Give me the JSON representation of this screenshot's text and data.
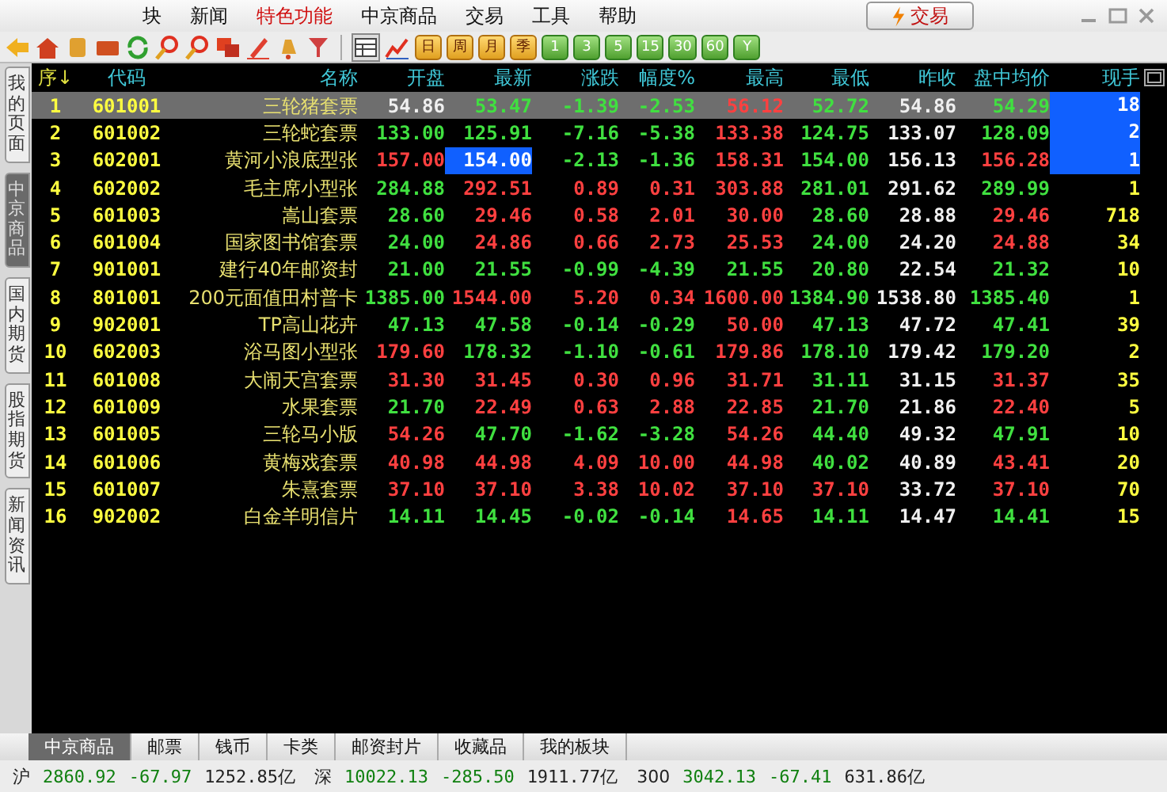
{
  "menu": [
    {
      "label": "块",
      "highlight": false
    },
    {
      "label": "新闻",
      "highlight": false
    },
    {
      "label": "特色功能",
      "highlight": true
    },
    {
      "label": "中京商品",
      "highlight": false
    },
    {
      "label": "交易",
      "highlight": false
    },
    {
      "label": "工具",
      "highlight": false
    },
    {
      "label": "帮助",
      "highlight": false
    }
  ],
  "trade_button": "交易",
  "period_buttons": [
    {
      "label": "日",
      "kind": "day"
    },
    {
      "label": "周",
      "kind": "day"
    },
    {
      "label": "月",
      "kind": "day"
    },
    {
      "label": "季",
      "kind": "day"
    },
    {
      "label": "1",
      "kind": "minute"
    },
    {
      "label": "3",
      "kind": "minute"
    },
    {
      "label": "5",
      "kind": "minute"
    },
    {
      "label": "15",
      "kind": "minute"
    },
    {
      "label": "30",
      "kind": "minute"
    },
    {
      "label": "60",
      "kind": "minute"
    },
    {
      "label": "Y",
      "kind": "minute"
    }
  ],
  "side_tabs": [
    {
      "label": "我的页面",
      "selected": false
    },
    {
      "label": "中京商品",
      "selected": true
    },
    {
      "label": "国内期货",
      "selected": false
    },
    {
      "label": "股指期货",
      "selected": false
    },
    {
      "label": "新闻资讯",
      "selected": false
    }
  ],
  "table": {
    "columns": [
      "序↓",
      "代码",
      "名称",
      "开盘",
      "最新",
      "涨跌",
      "幅度%",
      "最高",
      "最低",
      "昨收",
      "盘中均价",
      "现手"
    ],
    "rows": [
      {
        "selected": true,
        "cells": [
          {
            "text": "1",
            "color": "#ffff40",
            "flash": false
          },
          {
            "text": "601001",
            "color": "#ffff40",
            "flash": false
          },
          {
            "text": "三轮猪套票",
            "color": "#e8e070",
            "flash": false
          },
          {
            "text": "54.86",
            "color": "#f0f0f0",
            "flash": false
          },
          {
            "text": "53.47",
            "color": "#40e040",
            "flash": false
          },
          {
            "text": "-1.39",
            "color": "#40e040",
            "flash": false
          },
          {
            "text": "-2.53",
            "color": "#40e040",
            "flash": false
          },
          {
            "text": "56.12",
            "color": "#ff4040",
            "flash": false
          },
          {
            "text": "52.72",
            "color": "#40e040",
            "flash": false
          },
          {
            "text": "54.86",
            "color": "#f0f0f0",
            "flash": false
          },
          {
            "text": "54.29",
            "color": "#40e040",
            "flash": false
          },
          {
            "text": "18",
            "flash": true
          }
        ]
      },
      {
        "selected": false,
        "cells": [
          {
            "text": "2",
            "color": "#ffff40",
            "flash": false
          },
          {
            "text": "601002",
            "color": "#ffff40",
            "flash": false
          },
          {
            "text": "三轮蛇套票",
            "color": "#e8e070",
            "flash": false
          },
          {
            "text": "133.00",
            "color": "#40e040",
            "flash": false
          },
          {
            "text": "125.91",
            "color": "#40e040",
            "flash": false
          },
          {
            "text": "-7.16",
            "color": "#40e040",
            "flash": false
          },
          {
            "text": "-5.38",
            "color": "#40e040",
            "flash": false
          },
          {
            "text": "133.38",
            "color": "#ff4040",
            "flash": false
          },
          {
            "text": "124.75",
            "color": "#40e040",
            "flash": false
          },
          {
            "text": "133.07",
            "color": "#f0f0f0",
            "flash": false
          },
          {
            "text": "128.09",
            "color": "#40e040",
            "flash": false
          },
          {
            "text": "2",
            "flash": true
          }
        ]
      },
      {
        "selected": false,
        "cells": [
          {
            "text": "3",
            "color": "#ffff40",
            "flash": false
          },
          {
            "text": "602001",
            "color": "#ffff40",
            "flash": false
          },
          {
            "text": "黄河小浪底型张",
            "color": "#e8e070",
            "flash": false
          },
          {
            "text": "157.00",
            "color": "#ff4040",
            "flash": false
          },
          {
            "text": "154.00",
            "flash": true
          },
          {
            "text": "-2.13",
            "color": "#40e040",
            "flash": false
          },
          {
            "text": "-1.36",
            "color": "#40e040",
            "flash": false
          },
          {
            "text": "158.31",
            "color": "#ff4040",
            "flash": false
          },
          {
            "text": "154.00",
            "color": "#40e040",
            "flash": false
          },
          {
            "text": "156.13",
            "color": "#f0f0f0",
            "flash": false
          },
          {
            "text": "156.28",
            "color": "#ff4040",
            "flash": false
          },
          {
            "text": "1",
            "flash": true
          }
        ]
      },
      {
        "selected": false,
        "cells": [
          {
            "text": "4",
            "color": "#ffff40",
            "flash": false
          },
          {
            "text": "602002",
            "color": "#ffff40",
            "flash": false
          },
          {
            "text": "毛主席小型张",
            "color": "#e8e070",
            "flash": false
          },
          {
            "text": "284.88",
            "color": "#40e040",
            "flash": false
          },
          {
            "text": "292.51",
            "color": "#ff4040",
            "flash": false
          },
          {
            "text": "0.89",
            "color": "#ff4040",
            "flash": false
          },
          {
            "text": "0.31",
            "color": "#ff4040",
            "flash": false
          },
          {
            "text": "303.88",
            "color": "#ff4040",
            "flash": false
          },
          {
            "text": "281.01",
            "color": "#40e040",
            "flash": false
          },
          {
            "text": "291.62",
            "color": "#f0f0f0",
            "flash": false
          },
          {
            "text": "289.99",
            "color": "#40e040",
            "flash": false
          },
          {
            "text": "1",
            "color": "#ffff40",
            "flash": false
          }
        ]
      },
      {
        "selected": false,
        "cells": [
          {
            "text": "5",
            "color": "#ffff40",
            "flash": false
          },
          {
            "text": "601003",
            "color": "#ffff40",
            "flash": false
          },
          {
            "text": "嵩山套票",
            "color": "#e8e070",
            "flash": false
          },
          {
            "text": "28.60",
            "color": "#40e040",
            "flash": false
          },
          {
            "text": "29.46",
            "color": "#ff4040",
            "flash": false
          },
          {
            "text": "0.58",
            "color": "#ff4040",
            "flash": false
          },
          {
            "text": "2.01",
            "color": "#ff4040",
            "flash": false
          },
          {
            "text": "30.00",
            "color": "#ff4040",
            "flash": false
          },
          {
            "text": "28.60",
            "color": "#40e040",
            "flash": false
          },
          {
            "text": "28.88",
            "color": "#f0f0f0",
            "flash": false
          },
          {
            "text": "29.46",
            "color": "#ff4040",
            "flash": false
          },
          {
            "text": "718",
            "color": "#ffff40",
            "flash": false
          }
        ]
      },
      {
        "selected": false,
        "cells": [
          {
            "text": "6",
            "color": "#ffff40",
            "flash": false
          },
          {
            "text": "601004",
            "color": "#ffff40",
            "flash": false
          },
          {
            "text": "国家图书馆套票",
            "color": "#e8e070",
            "flash": false
          },
          {
            "text": "24.00",
            "color": "#40e040",
            "flash": false
          },
          {
            "text": "24.86",
            "color": "#ff4040",
            "flash": false
          },
          {
            "text": "0.66",
            "color": "#ff4040",
            "flash": false
          },
          {
            "text": "2.73",
            "color": "#ff4040",
            "flash": false
          },
          {
            "text": "25.53",
            "color": "#ff4040",
            "flash": false
          },
          {
            "text": "24.00",
            "color": "#40e040",
            "flash": false
          },
          {
            "text": "24.20",
            "color": "#f0f0f0",
            "flash": false
          },
          {
            "text": "24.88",
            "color": "#ff4040",
            "flash": false
          },
          {
            "text": "34",
            "color": "#ffff40",
            "flash": false
          }
        ]
      },
      {
        "selected": false,
        "cells": [
          {
            "text": "7",
            "color": "#ffff40",
            "flash": false
          },
          {
            "text": "901001",
            "color": "#ffff40",
            "flash": false
          },
          {
            "text": "建行40年邮资封",
            "color": "#e8e070",
            "flash": false
          },
          {
            "text": "21.00",
            "color": "#40e040",
            "flash": false
          },
          {
            "text": "21.55",
            "color": "#40e040",
            "flash": false
          },
          {
            "text": "-0.99",
            "color": "#40e040",
            "flash": false
          },
          {
            "text": "-4.39",
            "color": "#40e040",
            "flash": false
          },
          {
            "text": "21.55",
            "color": "#40e040",
            "flash": false
          },
          {
            "text": "20.80",
            "color": "#40e040",
            "flash": false
          },
          {
            "text": "22.54",
            "color": "#f0f0f0",
            "flash": false
          },
          {
            "text": "21.32",
            "color": "#40e040",
            "flash": false
          },
          {
            "text": "10",
            "color": "#ffff40",
            "flash": false
          }
        ]
      },
      {
        "selected": false,
        "cells": [
          {
            "text": "8",
            "color": "#ffff40",
            "flash": false
          },
          {
            "text": "801001",
            "color": "#ffff40",
            "flash": false
          },
          {
            "text": "200元面值田村普卡",
            "color": "#e8e070",
            "flash": false
          },
          {
            "text": "1385.00",
            "color": "#40e040",
            "flash": false
          },
          {
            "text": "1544.00",
            "color": "#ff4040",
            "flash": false
          },
          {
            "text": "5.20",
            "color": "#ff4040",
            "flash": false
          },
          {
            "text": "0.34",
            "color": "#ff4040",
            "flash": false
          },
          {
            "text": "1600.00",
            "color": "#ff4040",
            "flash": false
          },
          {
            "text": "1384.90",
            "color": "#40e040",
            "flash": false
          },
          {
            "text": "1538.80",
            "color": "#f0f0f0",
            "flash": false
          },
          {
            "text": "1385.40",
            "color": "#40e040",
            "flash": false
          },
          {
            "text": "1",
            "color": "#ffff40",
            "flash": false
          }
        ]
      },
      {
        "selected": false,
        "cells": [
          {
            "text": "9",
            "color": "#ffff40",
            "flash": false
          },
          {
            "text": "902001",
            "color": "#ffff40",
            "flash": false
          },
          {
            "text": "TP高山花卉",
            "color": "#e8e070",
            "flash": false
          },
          {
            "text": "47.13",
            "color": "#40e040",
            "flash": false
          },
          {
            "text": "47.58",
            "color": "#40e040",
            "flash": false
          },
          {
            "text": "-0.14",
            "color": "#40e040",
            "flash": false
          },
          {
            "text": "-0.29",
            "color": "#40e040",
            "flash": false
          },
          {
            "text": "50.00",
            "color": "#ff4040",
            "flash": false
          },
          {
            "text": "47.13",
            "color": "#40e040",
            "flash": false
          },
          {
            "text": "47.72",
            "color": "#f0f0f0",
            "flash": false
          },
          {
            "text": "47.41",
            "color": "#40e040",
            "flash": false
          },
          {
            "text": "39",
            "color": "#ffff40",
            "flash": false
          }
        ]
      },
      {
        "selected": false,
        "cells": [
          {
            "text": "10",
            "color": "#ffff40",
            "flash": false
          },
          {
            "text": "602003",
            "color": "#ffff40",
            "flash": false
          },
          {
            "text": "浴马图小型张",
            "color": "#e8e070",
            "flash": false
          },
          {
            "text": "179.60",
            "color": "#ff4040",
            "flash": false
          },
          {
            "text": "178.32",
            "color": "#40e040",
            "flash": false
          },
          {
            "text": "-1.10",
            "color": "#40e040",
            "flash": false
          },
          {
            "text": "-0.61",
            "color": "#40e040",
            "flash": false
          },
          {
            "text": "179.86",
            "color": "#ff4040",
            "flash": false
          },
          {
            "text": "178.10",
            "color": "#40e040",
            "flash": false
          },
          {
            "text": "179.42",
            "color": "#f0f0f0",
            "flash": false
          },
          {
            "text": "179.20",
            "color": "#40e040",
            "flash": false
          },
          {
            "text": "2",
            "color": "#ffff40",
            "flash": false
          }
        ]
      },
      {
        "selected": false,
        "cells": [
          {
            "text": "11",
            "color": "#ffff40",
            "flash": false
          },
          {
            "text": "601008",
            "color": "#ffff40",
            "flash": false
          },
          {
            "text": "大闹天宫套票",
            "color": "#e8e070",
            "flash": false
          },
          {
            "text": "31.30",
            "color": "#ff4040",
            "flash": false
          },
          {
            "text": "31.45",
            "color": "#ff4040",
            "flash": false
          },
          {
            "text": "0.30",
            "color": "#ff4040",
            "flash": false
          },
          {
            "text": "0.96",
            "color": "#ff4040",
            "flash": false
          },
          {
            "text": "31.71",
            "color": "#ff4040",
            "flash": false
          },
          {
            "text": "31.11",
            "color": "#40e040",
            "flash": false
          },
          {
            "text": "31.15",
            "color": "#f0f0f0",
            "flash": false
          },
          {
            "text": "31.37",
            "color": "#ff4040",
            "flash": false
          },
          {
            "text": "35",
            "color": "#ffff40",
            "flash": false
          }
        ]
      },
      {
        "selected": false,
        "cells": [
          {
            "text": "12",
            "color": "#ffff40",
            "flash": false
          },
          {
            "text": "601009",
            "color": "#ffff40",
            "flash": false
          },
          {
            "text": "水果套票",
            "color": "#e8e070",
            "flash": false
          },
          {
            "text": "21.70",
            "color": "#40e040",
            "flash": false
          },
          {
            "text": "22.49",
            "color": "#ff4040",
            "flash": false
          },
          {
            "text": "0.63",
            "color": "#ff4040",
            "flash": false
          },
          {
            "text": "2.88",
            "color": "#ff4040",
            "flash": false
          },
          {
            "text": "22.85",
            "color": "#ff4040",
            "flash": false
          },
          {
            "text": "21.70",
            "color": "#40e040",
            "flash": false
          },
          {
            "text": "21.86",
            "color": "#f0f0f0",
            "flash": false
          },
          {
            "text": "22.40",
            "color": "#ff4040",
            "flash": false
          },
          {
            "text": "5",
            "color": "#ffff40",
            "flash": false
          }
        ]
      },
      {
        "selected": false,
        "cells": [
          {
            "text": "13",
            "color": "#ffff40",
            "flash": false
          },
          {
            "text": "601005",
            "color": "#ffff40",
            "flash": false
          },
          {
            "text": "三轮马小版",
            "color": "#e8e070",
            "flash": false
          },
          {
            "text": "54.26",
            "color": "#ff4040",
            "flash": false
          },
          {
            "text": "47.70",
            "color": "#40e040",
            "flash": false
          },
          {
            "text": "-1.62",
            "color": "#40e040",
            "flash": false
          },
          {
            "text": "-3.28",
            "color": "#40e040",
            "flash": false
          },
          {
            "text": "54.26",
            "color": "#ff4040",
            "flash": false
          },
          {
            "text": "44.40",
            "color": "#40e040",
            "flash": false
          },
          {
            "text": "49.32",
            "color": "#f0f0f0",
            "flash": false
          },
          {
            "text": "47.91",
            "color": "#40e040",
            "flash": false
          },
          {
            "text": "10",
            "color": "#ffff40",
            "flash": false
          }
        ]
      },
      {
        "selected": false,
        "cells": [
          {
            "text": "14",
            "color": "#ffff40",
            "flash": false
          },
          {
            "text": "601006",
            "color": "#ffff40",
            "flash": false
          },
          {
            "text": "黄梅戏套票",
            "color": "#e8e070",
            "flash": false
          },
          {
            "text": "40.98",
            "color": "#ff4040",
            "flash": false
          },
          {
            "text": "44.98",
            "color": "#ff4040",
            "flash": false
          },
          {
            "text": "4.09",
            "color": "#ff4040",
            "flash": false
          },
          {
            "text": "10.00",
            "color": "#ff4040",
            "flash": false
          },
          {
            "text": "44.98",
            "color": "#ff4040",
            "flash": false
          },
          {
            "text": "40.02",
            "color": "#40e040",
            "flash": false
          },
          {
            "text": "40.89",
            "color": "#f0f0f0",
            "flash": false
          },
          {
            "text": "43.41",
            "color": "#ff4040",
            "flash": false
          },
          {
            "text": "20",
            "color": "#ffff40",
            "flash": false
          }
        ]
      },
      {
        "selected": false,
        "cells": [
          {
            "text": "15",
            "color": "#ffff40",
            "flash": false
          },
          {
            "text": "601007",
            "color": "#ffff40",
            "flash": false
          },
          {
            "text": "朱熹套票",
            "color": "#e8e070",
            "flash": false
          },
          {
            "text": "37.10",
            "color": "#ff4040",
            "flash": false
          },
          {
            "text": "37.10",
            "color": "#ff4040",
            "flash": false
          },
          {
            "text": "3.38",
            "color": "#ff4040",
            "flash": false
          },
          {
            "text": "10.02",
            "color": "#ff4040",
            "flash": false
          },
          {
            "text": "37.10",
            "color": "#ff4040",
            "flash": false
          },
          {
            "text": "37.10",
            "color": "#ff4040",
            "flash": false
          },
          {
            "text": "33.72",
            "color": "#f0f0f0",
            "flash": false
          },
          {
            "text": "37.10",
            "color": "#ff4040",
            "flash": false
          },
          {
            "text": "70",
            "color": "#ffff40",
            "flash": false
          }
        ]
      },
      {
        "selected": false,
        "cells": [
          {
            "text": "16",
            "color": "#ffff40",
            "flash": false
          },
          {
            "text": "902002",
            "color": "#ffff40",
            "flash": false
          },
          {
            "text": "白金羊明信片",
            "color": "#e8e070",
            "flash": false
          },
          {
            "text": "14.11",
            "color": "#40e040",
            "flash": false
          },
          {
            "text": "14.45",
            "color": "#40e040",
            "flash": false
          },
          {
            "text": "-0.02",
            "color": "#40e040",
            "flash": false
          },
          {
            "text": "-0.14",
            "color": "#40e040",
            "flash": false
          },
          {
            "text": "14.65",
            "color": "#ff4040",
            "flash": false
          },
          {
            "text": "14.11",
            "color": "#40e040",
            "flash": false
          },
          {
            "text": "14.47",
            "color": "#f0f0f0",
            "flash": false
          },
          {
            "text": "14.41",
            "color": "#40e040",
            "flash": false
          },
          {
            "text": "15",
            "color": "#ffff40",
            "flash": false
          }
        ]
      }
    ]
  },
  "bottom_tabs": [
    {
      "label": "中京商品",
      "selected": true
    },
    {
      "label": "邮票",
      "selected": false
    },
    {
      "label": "钱币",
      "selected": false
    },
    {
      "label": "卡类",
      "selected": false
    },
    {
      "label": "邮资封片",
      "selected": false
    },
    {
      "label": "收藏品",
      "selected": false
    },
    {
      "label": "我的板块",
      "selected": false
    }
  ],
  "status_bar": [
    {
      "name": "沪",
      "index": "2860.92",
      "change": "-67.97",
      "amount": "1252.85亿"
    },
    {
      "name": "深",
      "index": "10022.13",
      "change": "-285.50",
      "amount": "1911.77亿"
    },
    {
      "name": "300",
      "index": "3042.13",
      "change": "-67.41",
      "amount": "631.86亿"
    }
  ]
}
